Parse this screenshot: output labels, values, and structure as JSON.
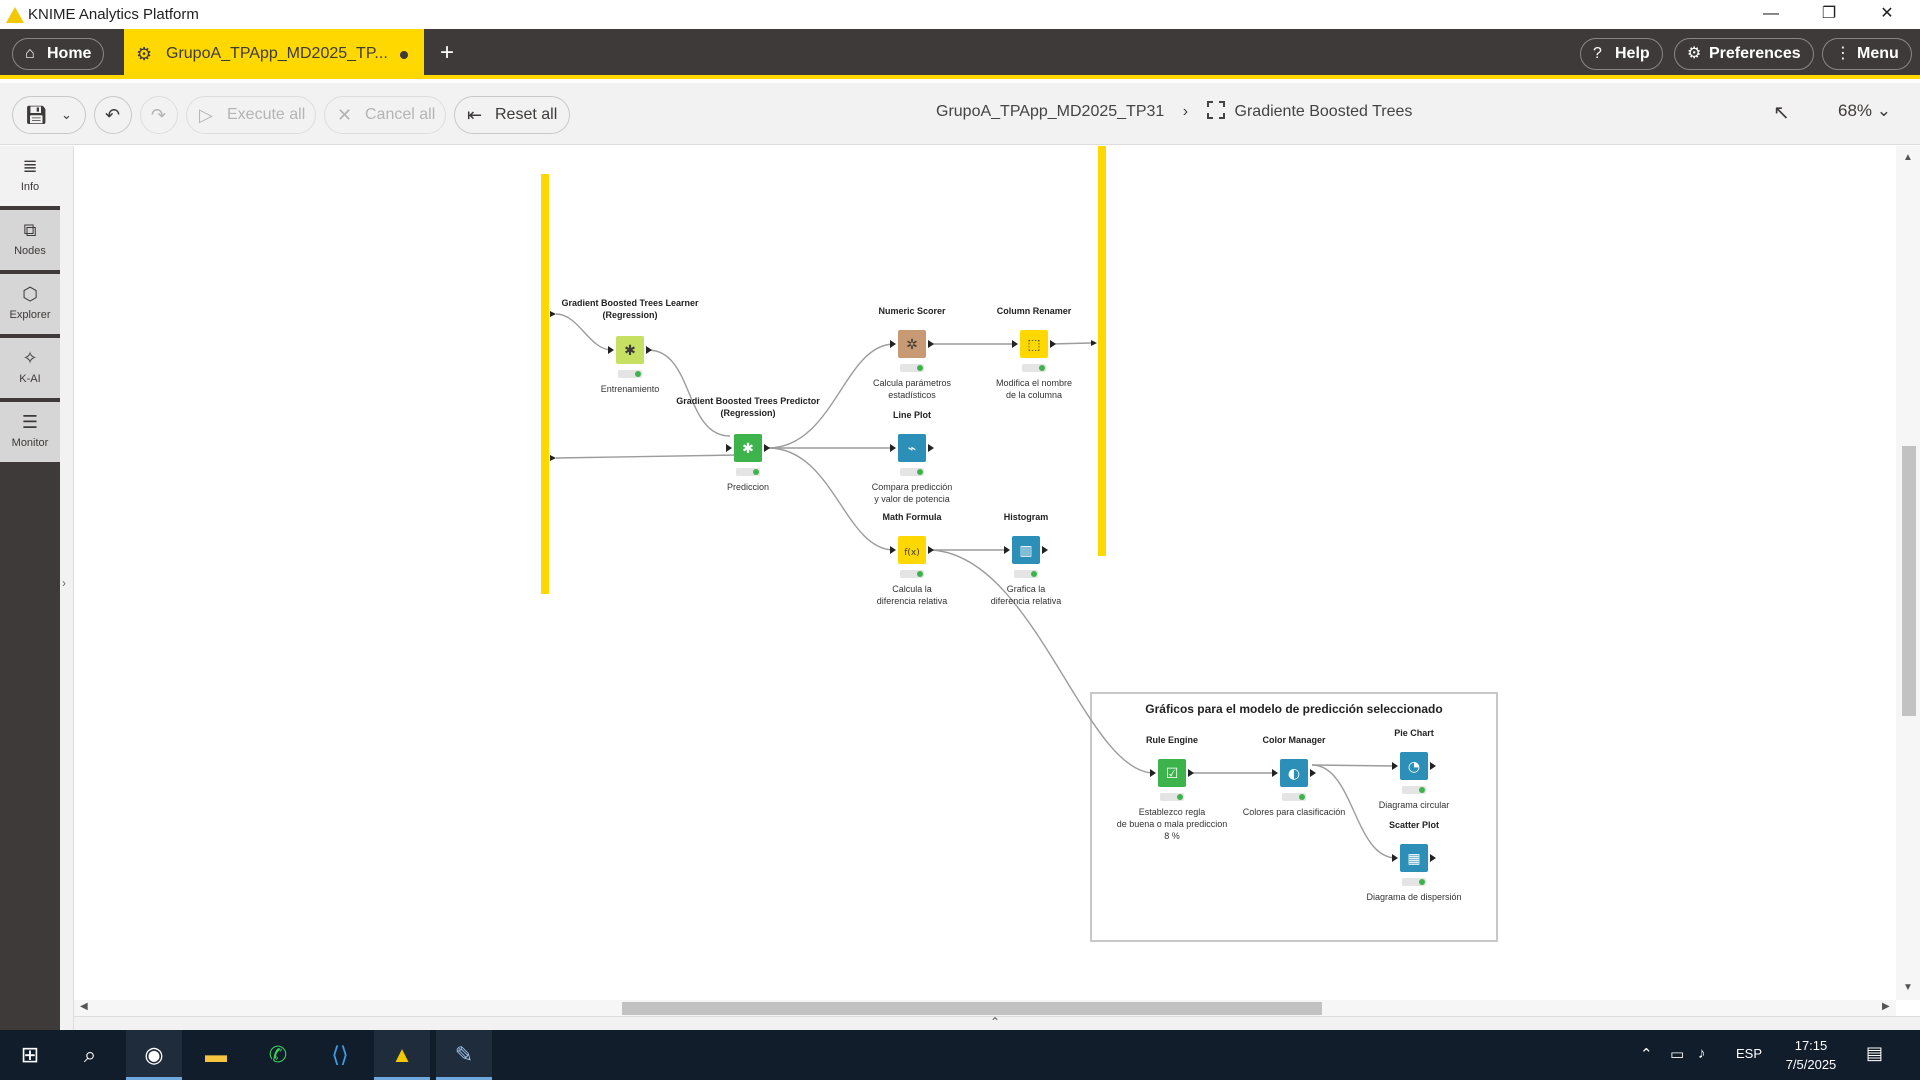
{
  "window": {
    "title": "KNIME Analytics Platform",
    "minimize": "—",
    "restore": "❐",
    "close": "✕"
  },
  "appbar": {
    "home_label": "Home",
    "tab_label": "GrupoA_TPApp_MD2025_TP...",
    "add_tab": "+",
    "help_label": "Help",
    "preferences_label": "Preferences",
    "menu_label": "Menu"
  },
  "toolbar": {
    "execute_all": "Execute all",
    "cancel_all": "Cancel all",
    "reset_all": "Reset all",
    "breadcrumb_workflow": "GrupoA_TPApp_MD2025_TP31",
    "breadcrumb_separator": "›",
    "breadcrumb_component": "Gradiente Boosted Trees",
    "zoom": "68%"
  },
  "sidebar": {
    "items": [
      {
        "label": "Info",
        "icon": "info-icon"
      },
      {
        "label": "Nodes",
        "icon": "nodes-icon"
      },
      {
        "label": "Explorer",
        "icon": "explorer-icon"
      },
      {
        "label": "K-AI",
        "icon": "kai-icon"
      },
      {
        "label": "Monitor",
        "icon": "monitor-icon"
      }
    ]
  },
  "workflow": {
    "colors": {
      "border": "#ffd800",
      "learner": "#c6e062",
      "predictor": "#3cb44b",
      "scorer": "#c79a74",
      "manipulator": "#ffd800",
      "view": "#2c8fb8",
      "annotation_border": "#c8c8c8"
    },
    "nodes": [
      {
        "id": "gbt-learner",
        "title": "Gradient Boosted Trees Learner",
        "title2": "(Regression)",
        "label": "Entrenamiento",
        "label2": ""
      },
      {
        "id": "gbt-predictor",
        "title": "Gradient Boosted Trees Predictor",
        "title2": "(Regression)",
        "label": "Prediccion",
        "label2": ""
      },
      {
        "id": "numeric-scorer",
        "title": "Numeric Scorer",
        "title2": "",
        "label": "Calcula parámetros",
        "label2": "estadísticos"
      },
      {
        "id": "column-renamer",
        "title": "Column Renamer",
        "title2": "",
        "label": "Modifica el nombre",
        "label2": "de la columna"
      },
      {
        "id": "line-plot",
        "title": "Line Plot",
        "title2": "",
        "label": "Compara predicción",
        "label2": "y valor de potencia"
      },
      {
        "id": "math-formula",
        "title": "Math Formula",
        "title2": "",
        "label": "Calcula la",
        "label2": "diferencia relativa"
      },
      {
        "id": "histogram",
        "title": "Histogram",
        "title2": "",
        "label": "Grafica la",
        "label2": "diferencia relativa"
      },
      {
        "id": "rule-engine",
        "title": "Rule Engine",
        "title2": "",
        "label": "Establezco regla",
        "label2": "de buena o mala prediccion",
        "label3": "8 %"
      },
      {
        "id": "color-manager",
        "title": "Color Manager",
        "title2": "",
        "label": "Colores para clasificación",
        "label2": ""
      },
      {
        "id": "pie-chart",
        "title": "Pie Chart",
        "title2": "",
        "label": "Diagrama circular",
        "label2": ""
      },
      {
        "id": "scatter-plot",
        "title": "Scatter Plot",
        "title2": "",
        "label": "Diagrama de dispersión",
        "label2": ""
      }
    ],
    "annotation_title": "Gráficos para el modelo de predicción seleccionado"
  },
  "taskbar": {
    "apps": [
      "windows-start-icon",
      "search-icon",
      "chrome-icon",
      "file-explorer-icon",
      "whatsapp-icon",
      "vscode-icon",
      "knime-icon",
      "paint-icon"
    ],
    "language": "ESP",
    "time": "17:15",
    "date": "7/5/2025"
  }
}
